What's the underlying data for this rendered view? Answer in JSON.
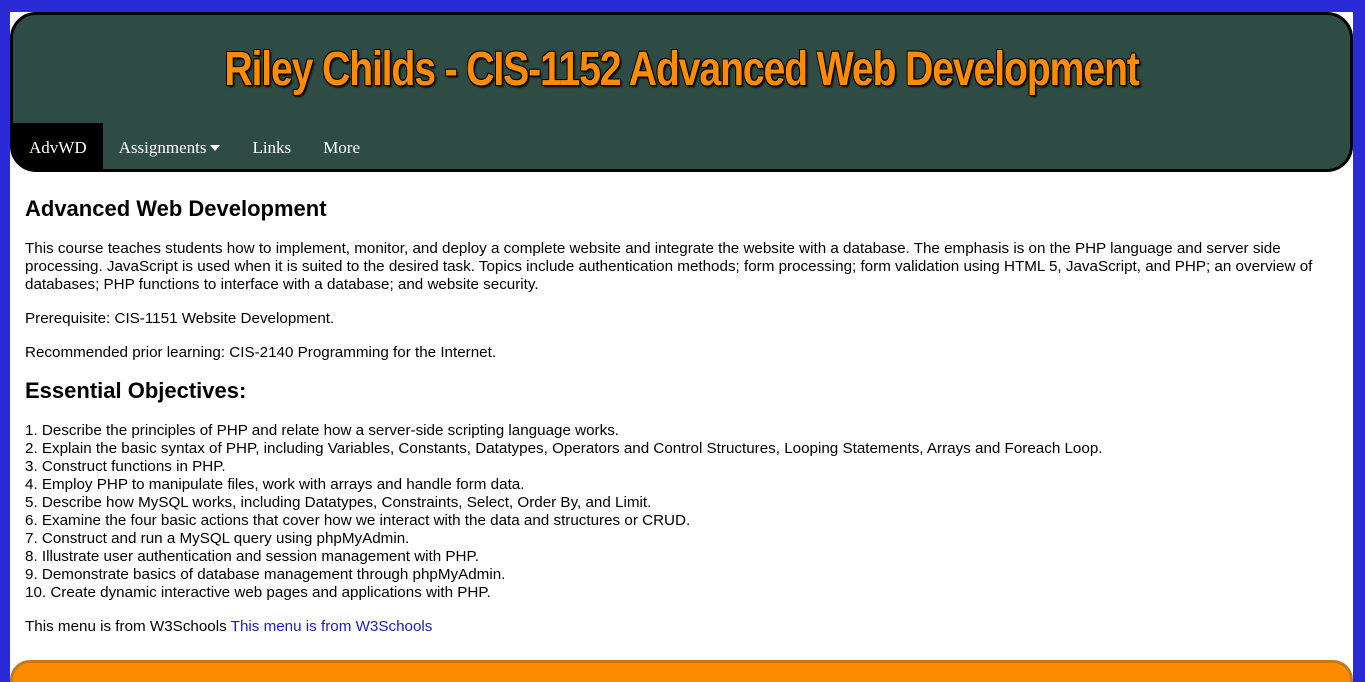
{
  "header": {
    "title": "Riley Childs - CIS-1152 Advanced Web Development"
  },
  "nav": {
    "items": [
      {
        "label": "AdvWD",
        "active": true
      },
      {
        "label": "Assignments",
        "dropdown": true
      },
      {
        "label": "Links"
      },
      {
        "label": "More"
      }
    ]
  },
  "main": {
    "heading": "Advanced Web Development",
    "description": "This course teaches students how to implement, monitor, and deploy a complete website and integrate the website with a database. The emphasis is on the PHP language and server side processing. JavaScript is used when it is suited to the desired task. Topics include authentication methods; form processing; form validation using HTML 5, JavaScript, and PHP; an overview of databases; PHP functions to interface with a database; and website security.",
    "prerequisite": "Prerequisite: CIS-1151 Website Development.",
    "recommended": "Recommended prior learning: CIS-2140 Programming for the Internet.",
    "objectives_heading": "Essential Objectives:",
    "objectives": [
      "1. Describe the principles of PHP and relate how a server-side scripting language works.",
      "2. Explain the basic syntax of PHP, including Variables, Constants, Datatypes, Operators and Control Structures, Looping Statements, Arrays and Foreach Loop.",
      "3. Construct functions in PHP.",
      "4. Employ PHP to manipulate files, work with arrays and handle form data.",
      "5. Describe how MySQL works, including Datatypes, Constraints, Select, Order By, and Limit.",
      "6. Examine the four basic actions that cover how we interact with the data and structures or CRUD.",
      "7. Construct and run a MySQL query using phpMyAdmin.",
      "8. Illustrate user authentication and session management with PHP.",
      "9. Demonstrate basics of database management through phpMyAdmin.",
      "10. Create dynamic interactive web pages and applications with PHP."
    ],
    "credit_text": "This menu is from W3Schools",
    "credit_link": "This menu is from W3Schools"
  },
  "colors": {
    "page_border": "#2a2ad6",
    "header_bg": "#2e4c44",
    "title_color": "#ff8c00",
    "nav_active_bg": "#000000",
    "link_color": "#1a1acc",
    "footer_bg": "#ff8c00"
  }
}
